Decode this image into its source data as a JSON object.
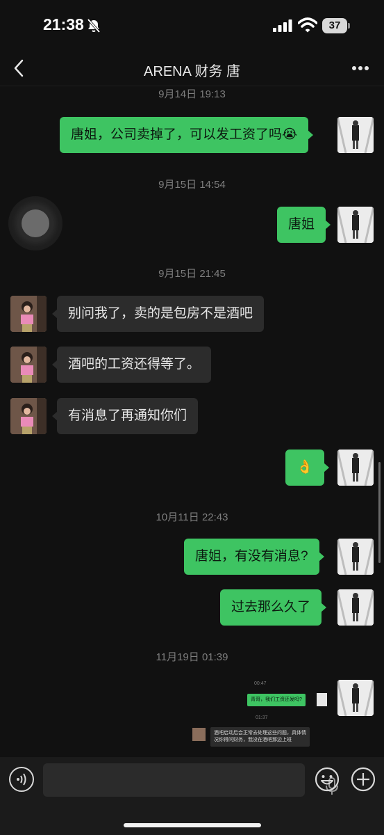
{
  "status_bar": {
    "time": "21:38",
    "battery": "37",
    "icons": [
      "bell-slash-icon",
      "signal-icon",
      "wifi-icon",
      "battery-icon"
    ]
  },
  "header": {
    "back_icon": "chevron-left-icon",
    "title": "ARENA 财务 唐",
    "more_icon": "ellipsis-icon"
  },
  "messages": {
    "ts1": "9月14日 19:13",
    "m1": "唐姐，公司卖掉了，可以发工资了吗😭",
    "ts2": "9月15日 14:54",
    "m2": "唐姐",
    "ts3": "9月15日 21:45",
    "m3": "别问我了，卖的是包房不是酒吧",
    "m4": "酒吧的工资还得等了。",
    "m5": "有消息了再通知你们",
    "m6": "👌",
    "ts4": "10月11日 22:43",
    "m7": "唐姐，有没有消息?",
    "m8": "过去那么久了",
    "ts5": "11月19日 01:39"
  },
  "screenshot_message": {
    "time1": "00:47",
    "sent": "青哥，我们工资还发吗?",
    "time2": "01:37",
    "reply": "酒吧启动后会正常去处理这些问题，具体情况你得问财务，我没在酒吧那边上班"
  },
  "input_bar": {
    "voice_icon": "voice-icon",
    "mic_icon": "microphone-icon",
    "emoji_icon": "emoji-icon",
    "plus_icon": "plus-icon"
  },
  "colors": {
    "background": "#111111",
    "outgoing_bubble": "#3ec462",
    "incoming_bubble": "#2c2c2c",
    "timestamp": "#7e7e7e"
  }
}
